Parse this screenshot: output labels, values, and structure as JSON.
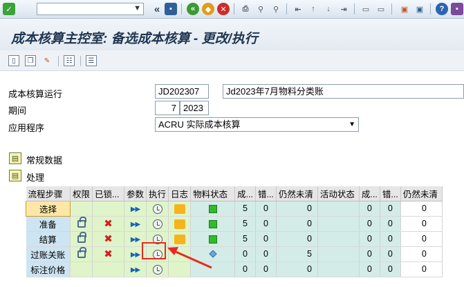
{
  "toolbar": {
    "icons": [
      "check-icon",
      "command-field",
      "dropdown-icon",
      "back-double-icon",
      "save-icon",
      "back-icon",
      "exit-icon",
      "cancel-icon",
      "print-icon",
      "find-icon",
      "find-next-icon",
      "first-page-icon",
      "prev-page-icon",
      "next-page-icon",
      "last-page-icon",
      "new-session-icon",
      "shortcut-icon",
      "help-icon",
      "layout-icon"
    ]
  },
  "header": {
    "title": "成本核算主控室: 备选成本核算 - 更改/执行"
  },
  "form": {
    "run_label": "成本核算运行",
    "run_value": "JD202307",
    "run_desc": "Jd2023年7月物料分类账",
    "period_label": "期间",
    "period_month": "7",
    "period_year": "2023",
    "app_label": "应用程序",
    "app_value": "ACRU 实际成本核算"
  },
  "sections": {
    "general": "常规数据",
    "processing": "处理"
  },
  "grid": {
    "headers": [
      "流程步骤",
      "权限",
      "已锁...",
      "参数",
      "执行",
      "日志",
      "物料状态",
      "成...",
      "错...",
      "仍然未清",
      "活动状态",
      "成...",
      "错...",
      "仍然未清"
    ],
    "rows": [
      {
        "step": "选择",
        "c1": "5",
        "c2": "0",
        "c3": "0",
        "c4": "0",
        "c5": "0",
        "c6": "0"
      },
      {
        "step": "准备",
        "c1": "5",
        "c2": "0",
        "c3": "0",
        "c4": "0",
        "c5": "0",
        "c6": "0"
      },
      {
        "step": "结算",
        "c1": "5",
        "c2": "0",
        "c3": "0",
        "c4": "0",
        "c5": "0",
        "c6": "0"
      },
      {
        "step": "过账关账",
        "c1": "0",
        "c2": "0",
        "c3": "5",
        "c4": "0",
        "c5": "0",
        "c6": "0"
      },
      {
        "step": "标注价格",
        "c1": "0",
        "c2": "0",
        "c3": "0",
        "c4": "0",
        "c5": "0",
        "c6": "0"
      }
    ]
  },
  "colors": {
    "accent_red": "#e8291f",
    "step_blue": "#cde4f2",
    "green_cell": "#dff5c9"
  }
}
